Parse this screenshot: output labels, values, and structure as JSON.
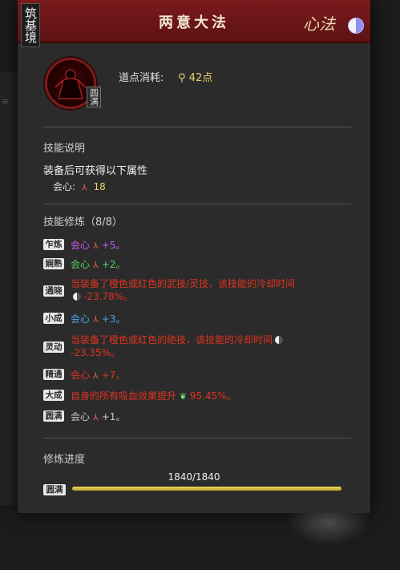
{
  "seal": "筑基境",
  "header": {
    "title": "两意大法",
    "calligraphy": "心法"
  },
  "skill": {
    "badge": "圆满",
    "cost_label": "道点消耗:",
    "cost_value": "42点"
  },
  "description": {
    "section_title": "技能说明",
    "main": "装备后可获得以下属性",
    "attr_name": "会心:",
    "attr_value": "18"
  },
  "cultivation": {
    "section_title": "技能修炼（8/8）",
    "rows": [
      {
        "tag": "乍炼",
        "text": "会心",
        "value": "+5。",
        "color": "#c45ae8"
      },
      {
        "tag": "娴熟",
        "text": "会心",
        "value": "+2。",
        "color": "#4fd35c"
      },
      {
        "tag": "通晓",
        "text1": "当装备了橙色或红色的武技/灵技，该技能的冷却时间",
        "text2": "-23.78%。"
      },
      {
        "tag": "小成",
        "text": "会心",
        "value": "+3。",
        "color": "#4aa5f0"
      },
      {
        "tag": "灵动",
        "text1": "当装备了橙色或红色的绝技，该技能的冷却时间",
        "text2": "-23.35%。"
      },
      {
        "tag": "精通",
        "text": "会心",
        "value": "+7。",
        "color": "#e0321f"
      },
      {
        "tag": "大成",
        "text1": "自身的所有吸血效果提升",
        "text2": "95.45%。"
      },
      {
        "tag": "圆满",
        "text": "会心",
        "value": "+1。",
        "color": "#c8c8c8"
      }
    ]
  },
  "progress": {
    "label": "修炼进度",
    "value_text": "1840/1840",
    "tag": "圆满",
    "fraction": 1.0
  },
  "icons": {
    "cost": "location-pin-icon",
    "attr": "tri-blade-icon",
    "cooldown": "moon-icon",
    "heal": "leaf-heart-icon",
    "top_right": "taiji-icon"
  }
}
